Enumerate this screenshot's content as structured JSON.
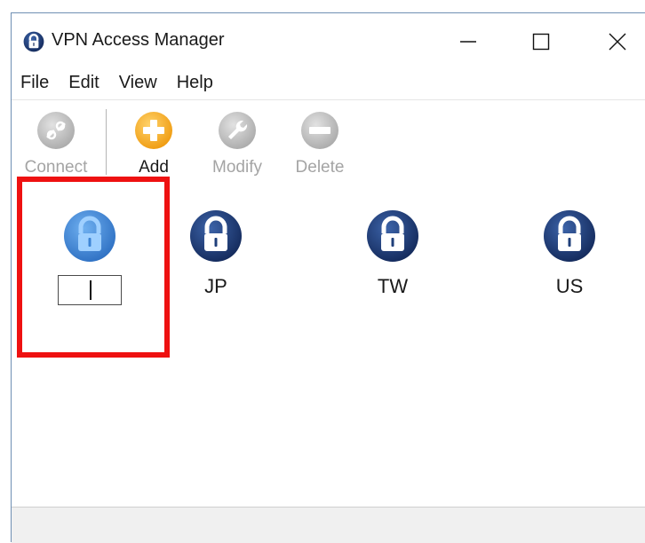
{
  "window": {
    "title": "VPN Access Manager"
  },
  "menu": [
    "File",
    "Edit",
    "View",
    "Help"
  ],
  "toolbar": {
    "connect": {
      "label": "Connect",
      "enabled": false,
      "icon": "connect-icon"
    },
    "add": {
      "label": "Add",
      "enabled": true,
      "icon": "add-icon"
    },
    "modify": {
      "label": "Modify",
      "enabled": false,
      "icon": "wrench-icon"
    },
    "delete": {
      "label": "Delete",
      "enabled": false,
      "icon": "minus-icon"
    }
  },
  "vpns": [
    {
      "label": "",
      "selected": true,
      "editing": true,
      "rename_value": "",
      "icon": "lock-icon"
    },
    {
      "label": "JP",
      "selected": false,
      "icon": "lock-icon"
    },
    {
      "label": "TW",
      "selected": false,
      "icon": "lock-icon"
    },
    {
      "label": "US",
      "selected": false,
      "icon": "lock-icon"
    }
  ],
  "colors": {
    "lock_dark": "#1f3f7a",
    "lock_selected": "#3d84d4",
    "add_accent": "#f2a71b",
    "disabled_icon": "#bdbdbd",
    "highlight": "#ee1111"
  }
}
